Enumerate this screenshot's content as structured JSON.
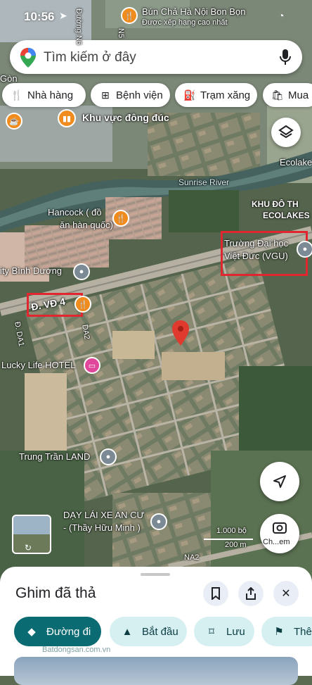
{
  "status": {
    "time": "10:56"
  },
  "search": {
    "placeholder": "Tìm kiếm ở đây"
  },
  "chips": [
    {
      "icon": "restaurant-icon",
      "label": "Nhà hàng"
    },
    {
      "icon": "hospital-icon",
      "label": "Bệnh viện"
    },
    {
      "icon": "gas-station-icon",
      "label": "Trạm xăng"
    },
    {
      "icon": "shopping-bag-icon",
      "label": "Mua s"
    }
  ],
  "map": {
    "top_restaurant": {
      "name": "Bún Chả Hà Nội Bon Bọn",
      "subtitle": "Được xếp hạng cao nhất"
    },
    "gon_label": "Gòn",
    "busy_area": "Khu vực đông đúc",
    "river": "Sunrise River",
    "ecolakes": "Ecolake",
    "urban_area_line1": "KHU ĐÔ TH",
    "urban_area_line2": "ECOLAKES",
    "hancock_line1": "Hancock ( đồ",
    "hancock_line2": "ăn hàn quốc)",
    "vgu_line1": "Trường Đại học",
    "vgu_line2": "Việt Đức (VGU)",
    "city_binh_duong": "ity Bình Dương",
    "road_vd4": "Đ. VĐ 4",
    "road_da1": "Đ. DA1",
    "road_da2": "DA2",
    "road_n6": "Đường N6",
    "road_n5": "N5",
    "road_na2": "NA2",
    "lucky_life": "Lucky Life HOTEL",
    "trung_tran": "Trung Trần LAND",
    "driving_school_line1": "DẠY LÁI XE AN CƯ",
    "driving_school_line2": "- (Thầy Hữu Minh )",
    "scale_ft": "1.000 bộ",
    "scale_m": "200 m",
    "lens_label": "Ch...em"
  },
  "sheet": {
    "title": "Ghim đã thả",
    "watermark": "Batdongsan.com.vn",
    "actions": [
      {
        "icon": "directions-icon",
        "label": "Đường đi"
      },
      {
        "icon": "navigation-icon",
        "label": "Bắt đầu"
      },
      {
        "icon": "bookmark-icon",
        "label": "Lưu"
      },
      {
        "icon": "flag-icon",
        "label": "Thêm"
      }
    ]
  },
  "colors": {
    "accent": "#0b6b72",
    "pin": "#e03a2f",
    "annotation": "#e0262f",
    "poi_orange": "#f08c1e",
    "poi_gray": "#7c8a96"
  }
}
